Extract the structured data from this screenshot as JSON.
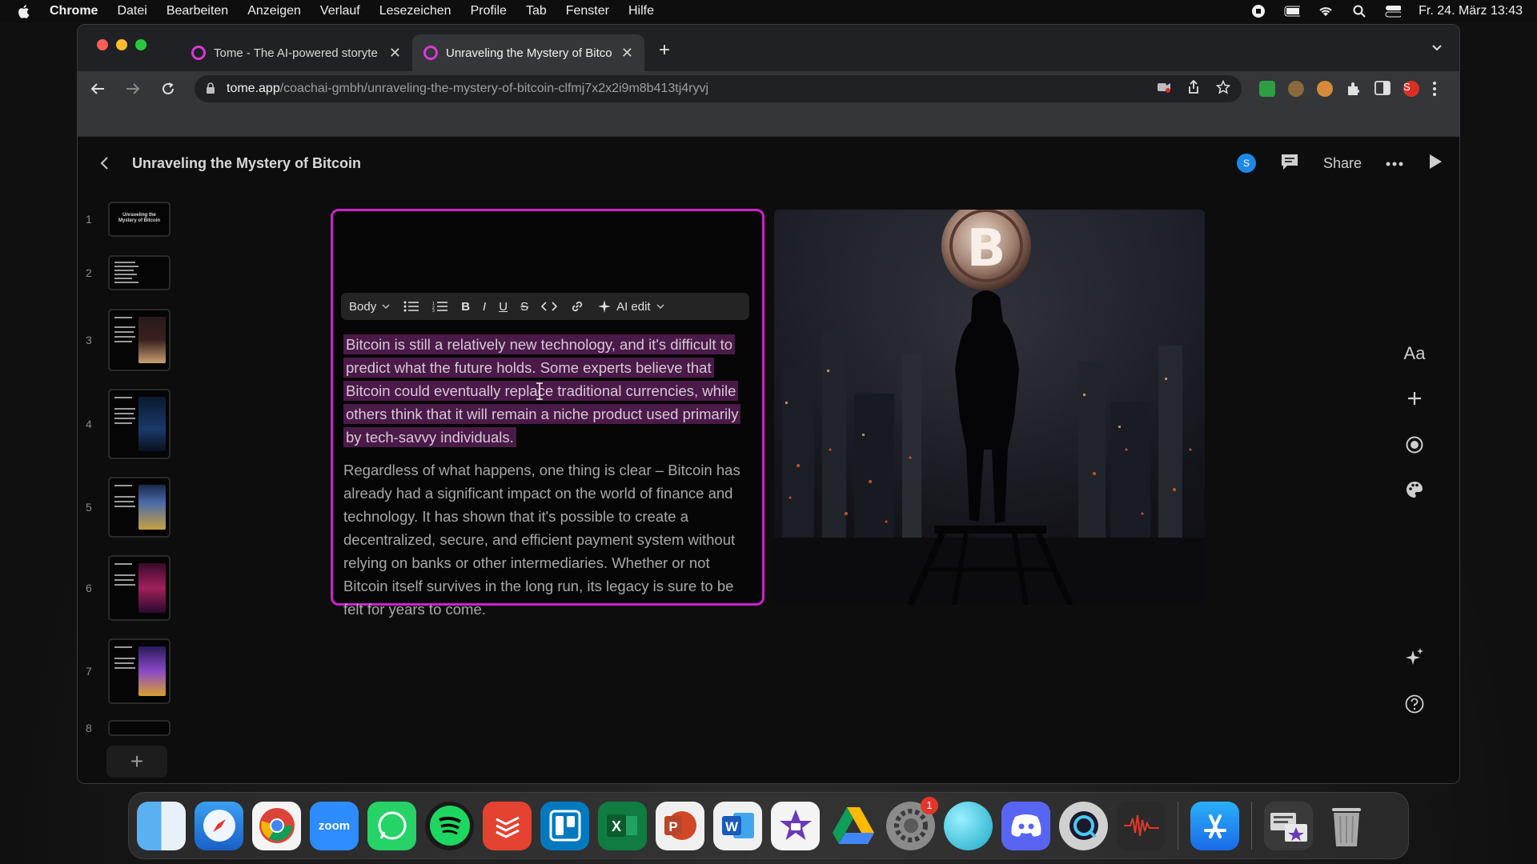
{
  "menubar": {
    "app": "Chrome",
    "items": [
      "Datei",
      "Bearbeiten",
      "Anzeigen",
      "Verlauf",
      "Lesezeichen",
      "Profile",
      "Tab",
      "Fenster",
      "Hilfe"
    ],
    "clock": "Fr. 24. März 13:43"
  },
  "browser": {
    "tabs": [
      {
        "title": "Tome - The AI-powered storyte",
        "active": false
      },
      {
        "title": "Unraveling the Mystery of Bitco",
        "active": true
      }
    ],
    "url_host": "tome.app",
    "url_path": "/coachai-gmbh/unraveling-the-mystery-of-bitcoin-clfmj7x2x2i9m8b413tj4ryvj",
    "profile_initial": "S"
  },
  "app": {
    "doc_title": "Unraveling the Mystery of Bitcoin",
    "user_initial": "S",
    "share_label": "Share",
    "thumbnails": [
      "1",
      "2",
      "3",
      "4",
      "5",
      "6",
      "7",
      "8"
    ],
    "thumb1_title": "Unraveling the Mystery of Bitcoin",
    "format_bar": {
      "style": "Body",
      "bold": "B",
      "italic": "I",
      "underline": "U",
      "strike": "S",
      "ai_edit": "AI edit"
    },
    "paragraph1": "Bitcoin is still a relatively new technology, and it's difficult to predict what the future holds. Some experts believe that Bitcoin could eventually replace traditional currencies, while others think that it will remain a niche product used primarily by tech-savvy individuals.",
    "paragraph2": "Regardless of what happens, one thing is clear – Bitcoin has already had a significant impact on the world of finance and technology. It has shown that it's possible to create a decentralized, secure, and efficient payment system without relying on banks or other intermediaries. Whether or not Bitcoin itself survives in the long run, its legacy is sure to be felt for years to come.",
    "side_tools": {
      "text": "Aa"
    }
  },
  "dock": {
    "zoom_label": "zoom",
    "system_settings_badge": "1"
  },
  "colors": {
    "accent_magenta": "#cc22cc",
    "highlight": "#4a1a48",
    "tome_pink": "#d63bd1"
  }
}
